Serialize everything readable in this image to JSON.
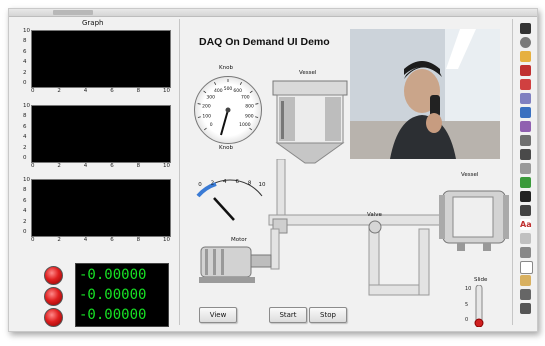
{
  "graph": {
    "caption": "Graph",
    "y_ticks": [
      "10",
      "8",
      "6",
      "4",
      "2",
      "0"
    ],
    "x_ticks": [
      "0",
      "2",
      "4",
      "6",
      "8",
      "10"
    ]
  },
  "numeric_display": {
    "rows": [
      "-0.00000",
      "-0.00000",
      "-0.00000"
    ]
  },
  "leds": [
    "red",
    "red",
    "red"
  ],
  "app_title": "DAQ On Demand UI Demo",
  "knob": {
    "top_label": "Knob",
    "bottom_label": "Knob",
    "scale": [
      "0",
      "100",
      "200",
      "300",
      "400",
      "500",
      "600",
      "700",
      "800",
      "900",
      "1000"
    ]
  },
  "meter": {
    "scale": [
      "0",
      "2",
      "4",
      "6",
      "8",
      "10"
    ]
  },
  "vessel_left_label": "Vessel",
  "vessel_right_label": "Vessel",
  "motor_label": "Motor",
  "valve_label": "Valve",
  "slide": {
    "label": "Slide",
    "ticks": [
      "10",
      "5",
      "0"
    ]
  },
  "buttons": {
    "view": "View",
    "start": "Start",
    "stop": "Stop"
  },
  "colors": {
    "graph_bg": "#000000",
    "numeric_fg": "#17e024",
    "led_on": "#e02020",
    "slide_fill": "#d02020"
  }
}
